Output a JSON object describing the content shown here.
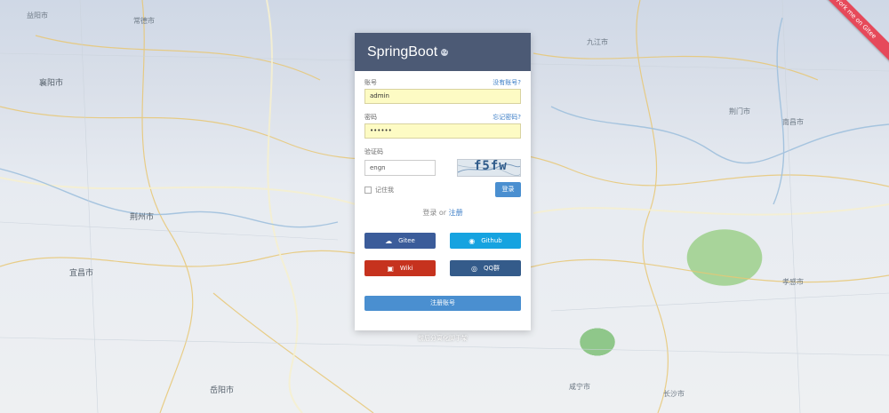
{
  "ribbon": {
    "label": "Fork me on Gitee"
  },
  "map": {
    "labels": [
      "襄阳市",
      "宜昌市",
      "荆州市",
      "岳阳市",
      "常德市",
      "益阳市",
      "长沙市",
      "咸宁市",
      "南昌市",
      "九江市",
      "荆门市",
      "孝感市"
    ]
  },
  "header": {
    "title": "SpringBoot",
    "badge": "v2"
  },
  "login": {
    "account_label": "账号",
    "account_link": "没有账号?",
    "account_value": "admin",
    "password_label": "密码",
    "password_link": "忘记密码?",
    "password_value": "••••••",
    "captcha_label": "验证码",
    "captcha_value": "engn",
    "captcha_text": "f5fw",
    "remember_label": "记住我",
    "login_button": "登录",
    "or_prefix": "登录 or ",
    "or_register": "注册",
    "register_button": "注册账号"
  },
  "social": {
    "gitee": "Gitee",
    "github": "Github",
    "wiki": "Wiki",
    "qq": "QQ群"
  },
  "below_card_text": "前后分离化脚手架"
}
